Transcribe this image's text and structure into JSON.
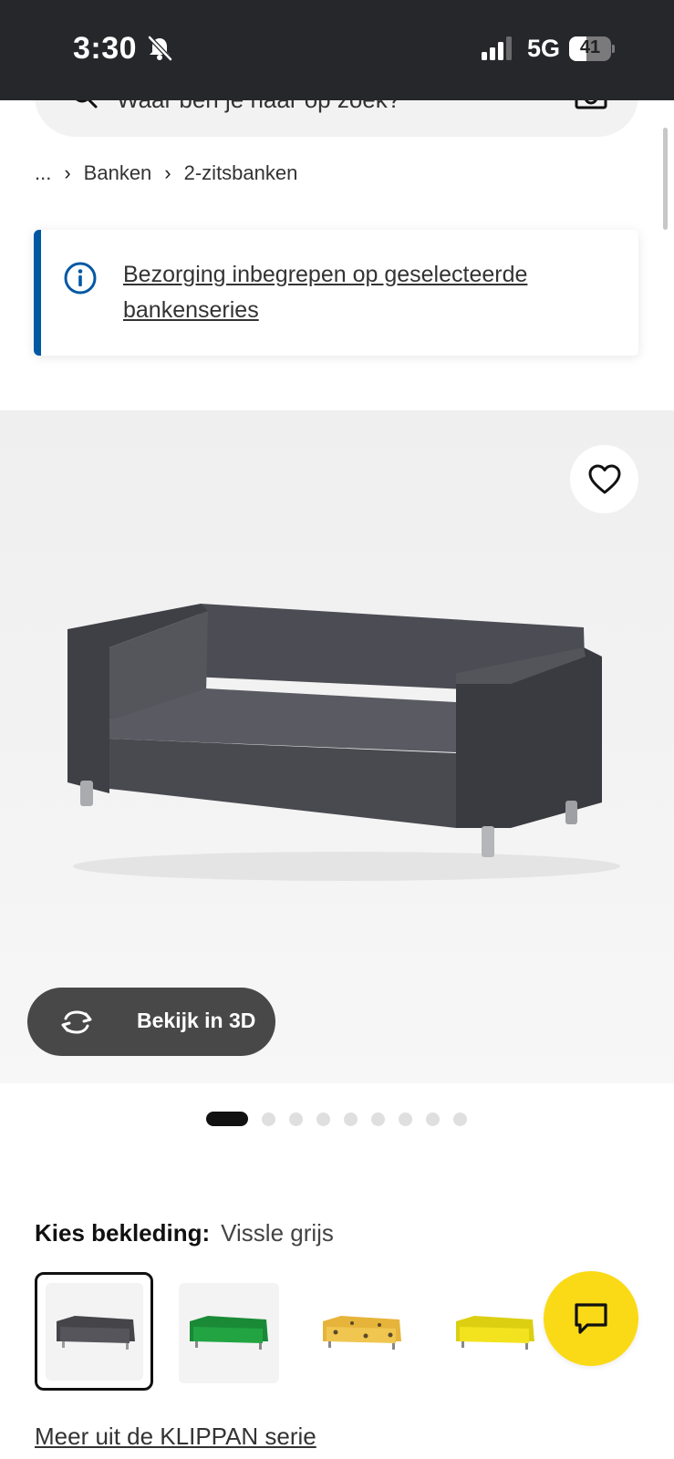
{
  "status_bar": {
    "time": "3:30",
    "network": "5G",
    "battery_level": "41",
    "battery_fraction": 0.41,
    "mute_icon": "bell-slash-icon",
    "signal_icon": "cellular-signal-icon"
  },
  "search": {
    "placeholder": "Waar ben je naar op zoek?",
    "icons": [
      "search-icon",
      "camera-icon"
    ]
  },
  "breadcrumb": {
    "items": [
      "...",
      "Banken",
      "2-zitsbanken"
    ]
  },
  "info_banner": {
    "icon": "info-icon",
    "text": "Bezorging inbegrepen op geselecteerde bankenseries",
    "accent_color": "#0058a3"
  },
  "product_gallery": {
    "favorite_icon": "heart-icon",
    "view_3d_label": "Bekijk in 3D",
    "view_3d_icon": "rotate-3d-icon",
    "image_count": 9,
    "active_index": 0
  },
  "upholstery": {
    "label": "Kies bekleding:",
    "selected_value": "Vissle grijs",
    "options": [
      {
        "color": "#4a4a50",
        "selected": true
      },
      {
        "color": "#1f9a3e",
        "selected": false
      },
      {
        "color": "#e8b93a",
        "selected": false,
        "pattern": "dots"
      },
      {
        "color": "#f1e320",
        "selected": false
      }
    ]
  },
  "chat": {
    "icon": "chat-bubble-icon",
    "color": "#fada16"
  },
  "series_link": "Meer uit de KLIPPAN serie"
}
